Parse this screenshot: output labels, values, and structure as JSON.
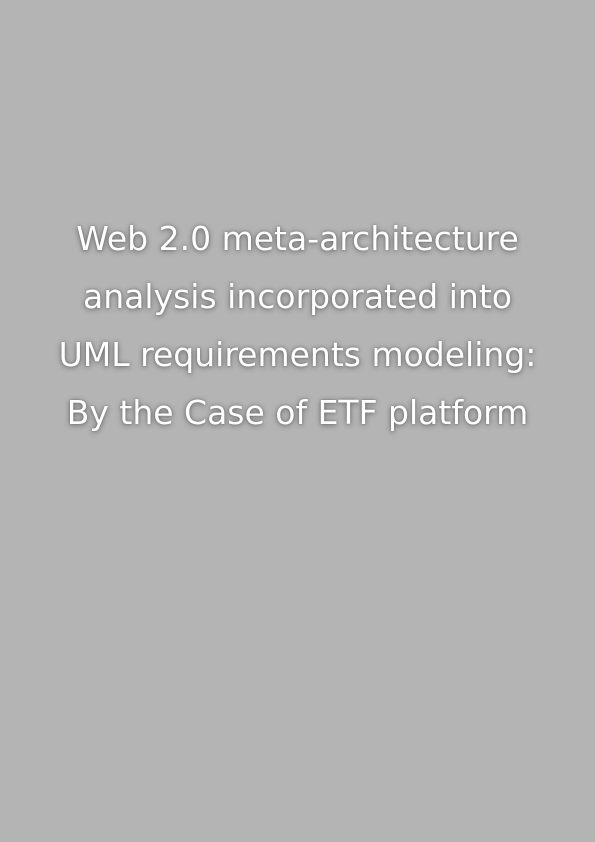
{
  "cover": {
    "background_color": "#b4b4b4",
    "text_color": "#ffffff",
    "title_lines": [
      "Web 2.0 meta-architecture",
      "analysis incorporated into",
      "UML requirements modeling:",
      "By the Case of ETF platform"
    ]
  }
}
